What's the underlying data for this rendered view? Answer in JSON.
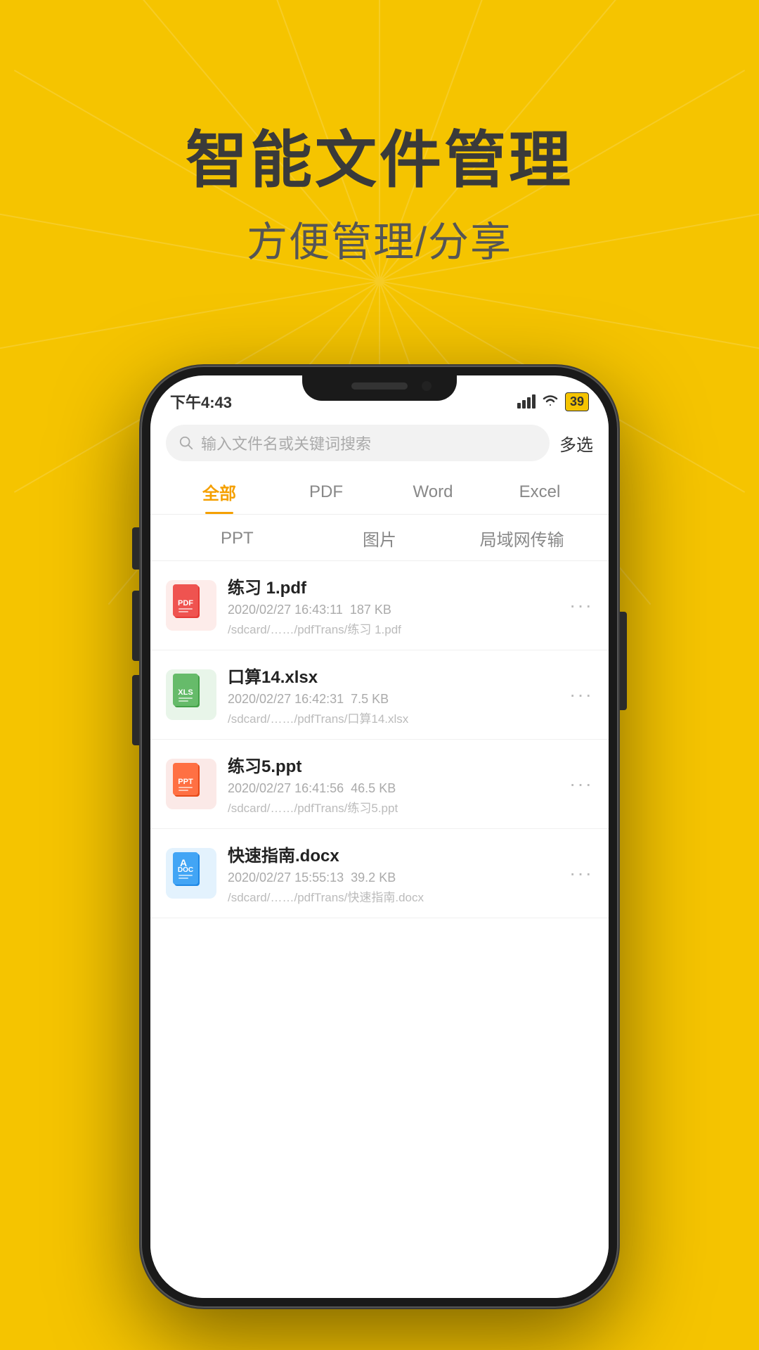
{
  "background_color": "#F5C400",
  "header": {
    "title": "智能文件管理",
    "subtitle": "方便管理/分享"
  },
  "status_bar": {
    "time": "下午4:43",
    "battery": "39",
    "signal_icon": "signal",
    "wifi_icon": "wifi",
    "notification_icon": "🔕"
  },
  "search": {
    "placeholder": "输入文件名或关键词搜索",
    "multi_select": "多选"
  },
  "tabs_row1": [
    {
      "label": "全部",
      "active": true
    },
    {
      "label": "PDF",
      "active": false
    },
    {
      "label": "Word",
      "active": false
    },
    {
      "label": "Excel",
      "active": false
    }
  ],
  "tabs_row2": [
    {
      "label": "PPT"
    },
    {
      "label": "图片"
    },
    {
      "label": "局域网传输"
    }
  ],
  "files": [
    {
      "name": "练习 1.pdf",
      "type": "pdf",
      "date": "2020/02/27 16:43:11",
      "size": "187 KB",
      "path": "/sdcard/……/pdfTrans/练习 1.pdf"
    },
    {
      "name": "口算14.xlsx",
      "type": "xlsx",
      "date": "2020/02/27 16:42:31",
      "size": "7.5 KB",
      "path": "/sdcard/……/pdfTrans/口算14.xlsx"
    },
    {
      "name": "练习5.ppt",
      "type": "ppt",
      "date": "2020/02/27 16:41:56",
      "size": "46.5 KB",
      "path": "/sdcard/……/pdfTrans/练习5.ppt"
    },
    {
      "name": "快速指南.docx",
      "type": "docx",
      "date": "2020/02/27 15:55:13",
      "size": "39.2 KB",
      "path": "/sdcard/……/pdfTrans/快速指南.docx"
    }
  ],
  "more_icon": "···"
}
